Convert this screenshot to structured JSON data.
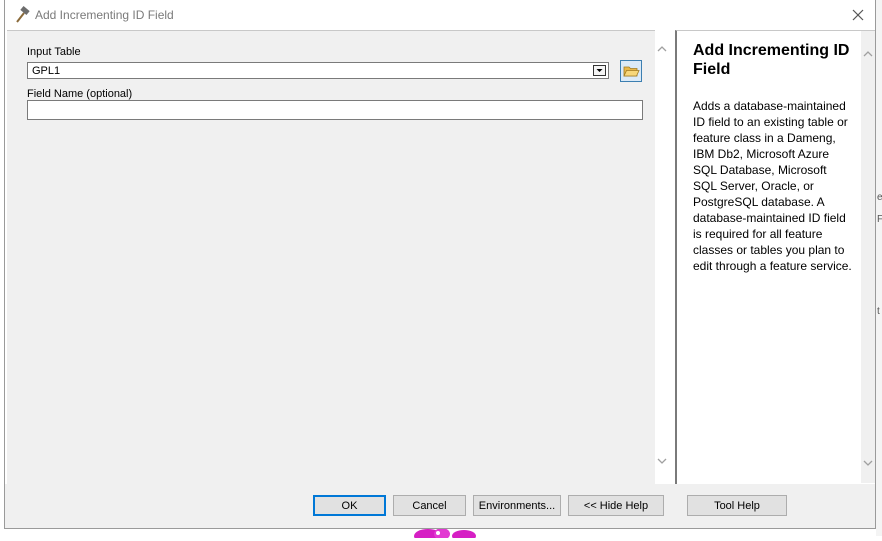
{
  "window": {
    "title": "Add Incrementing ID Field",
    "close_glyph": "✕"
  },
  "params": {
    "input_table_label": "Input Table",
    "input_table_value": "GPL1",
    "field_name_label": "Field Name (optional)",
    "field_name_value": ""
  },
  "help": {
    "title": "Add Incrementing ID Field",
    "body": "Adds a database-maintained ID field to an existing table or feature class in a Dameng, IBM Db2, Microsoft Azure SQL Database, Microsoft SQL Server, Oracle, or PostgreSQL database. A database-maintained ID field is required for all feature classes or tables you plan to edit through a feature service."
  },
  "buttons": {
    "ok": "OK",
    "cancel": "Cancel",
    "environments": "Environments...",
    "hide_help": "<< Hide Help",
    "tool_help": "Tool Help"
  },
  "icons": {
    "title": "hammer-icon",
    "browse": "open-folder-icon",
    "dropdown": "chevron-down-icon"
  },
  "background_marks": [
    "e",
    "F",
    "t"
  ],
  "colors": {
    "accent": "#0078d7",
    "panel": "#f0f0f0",
    "title_text": "#7a7a7a"
  }
}
